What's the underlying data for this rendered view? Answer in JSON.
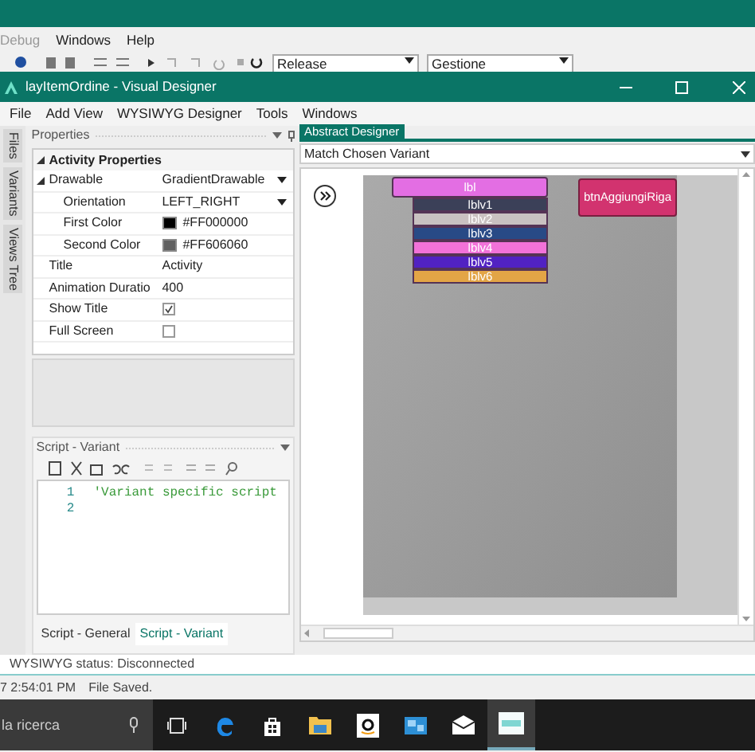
{
  "ide": {
    "menu": [
      "Debug",
      "Windows",
      "Help"
    ],
    "configuration": "Release",
    "project": "Gestione"
  },
  "window": {
    "title": "layItemOrdine - Visual Designer"
  },
  "menu": [
    "File",
    "Add View",
    "WYSIWYG Designer",
    "Tools",
    "Windows"
  ],
  "side_tabs": [
    "Files",
    "Variants",
    "Views Tree"
  ],
  "properties": {
    "title": "Properties",
    "groups": [
      {
        "label": "Activity Properties",
        "expanded": true,
        "children": [
          {
            "label": "Drawable",
            "kind": "dropdown",
            "value": "GradientDrawable",
            "expanded": true,
            "children": [
              {
                "label": "Orientation",
                "kind": "dropdown",
                "value": "LEFT_RIGHT"
              },
              {
                "label": "First Color",
                "kind": "color",
                "value": "#FF000000",
                "color": "#000000"
              },
              {
                "label": "Second Color",
                "kind": "color",
                "value": "#FF606060",
                "color": "#606060"
              }
            ]
          },
          {
            "label": "Title",
            "kind": "text",
            "value": "Activity"
          },
          {
            "label": "Animation Duratio",
            "kind": "text",
            "value": "400"
          },
          {
            "label": "Show Title",
            "kind": "checkbox",
            "checked": true
          },
          {
            "label": "Full Screen",
            "kind": "checkbox",
            "checked": false
          }
        ]
      }
    ]
  },
  "script": {
    "title": "Script - Variant",
    "lines": [
      {
        "number": "1",
        "text": "'Variant specific script"
      },
      {
        "number": "2"
      }
    ],
    "tabs": [
      {
        "label": "Script - General",
        "selected": false
      },
      {
        "label": "Script - Variant",
        "selected": true
      }
    ]
  },
  "designer": {
    "tab": "Abstract Designer",
    "variant": "Match Chosen Variant",
    "views": [
      {
        "label": "lbl",
        "color": "#e36ee3"
      },
      {
        "label": "lblv1",
        "color": "#3b4058"
      },
      {
        "label": "lblv2",
        "color": "#c9c1c1"
      },
      {
        "label": "lblv3",
        "color": "#284a86"
      },
      {
        "label": "lblv4",
        "color": "#f272d9"
      },
      {
        "label": "lblv5",
        "color": "#5122c2"
      },
      {
        "label": "lblv6",
        "color": "#e3a546"
      }
    ],
    "button": {
      "label": "btnAggiungiRiga",
      "color": "#d2336f"
    }
  },
  "status": "WYSIWYG status: Disconnected",
  "log": {
    "time": "7 2:54:01 PM",
    "message": "File Saved."
  },
  "taskbar": {
    "search": "la ricerca",
    "apps": [
      {
        "kind": "taskview",
        "selected": false
      },
      {
        "kind": "edge",
        "selected": false
      },
      {
        "kind": "store",
        "selected": false
      },
      {
        "kind": "folder",
        "selected": false
      },
      {
        "kind": "amazon",
        "selected": false
      },
      {
        "kind": "photos",
        "selected": false
      },
      {
        "kind": "mail",
        "selected": false
      },
      {
        "kind": "app",
        "selected": true
      }
    ]
  }
}
